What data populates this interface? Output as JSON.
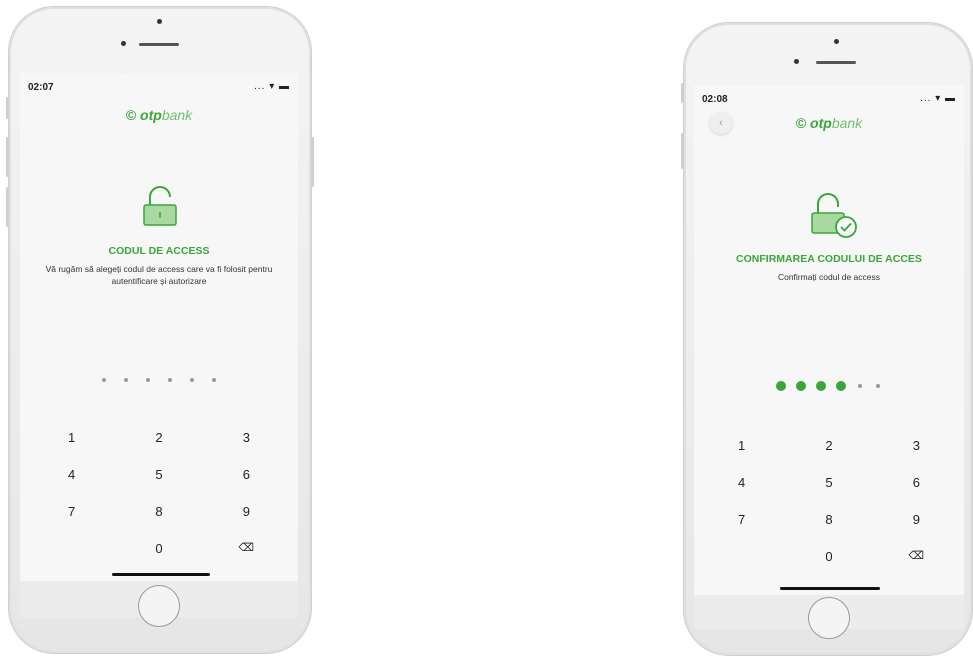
{
  "phone_left": {
    "status": {
      "time": "02:07",
      "right": "... ▾ ▬"
    },
    "brand": {
      "logo_mark": "©",
      "otp": "otp",
      "bank": "bank"
    },
    "lock_icon": "lock-icon",
    "title": "CODUL DE ACCESS",
    "description": "Vă rugăm să alegeți codul de access care va fi folosit pentru autentificare și autorizare",
    "pin": {
      "length": 6,
      "filled": 0
    },
    "keypad": [
      "1",
      "2",
      "3",
      "4",
      "5",
      "6",
      "7",
      "8",
      "9",
      "",
      "0",
      "⌫"
    ]
  },
  "phone_right": {
    "status": {
      "time": "02:08",
      "right": "... ▾ ▬"
    },
    "back": "‹",
    "brand": {
      "logo_mark": "©",
      "otp": "otp",
      "bank": "bank"
    },
    "lock_icon": "lock-check-icon",
    "title": "CONFIRMAREA CODULUI DE ACCES",
    "description": "Confirmați codul de access",
    "pin": {
      "length": 6,
      "filled": 4
    },
    "keypad": [
      "1",
      "2",
      "3",
      "4",
      "5",
      "6",
      "7",
      "8",
      "9",
      "",
      "0",
      "⌫"
    ]
  },
  "colors": {
    "brand_green": "#3aa53a",
    "light_green": "#a9d8a0"
  }
}
